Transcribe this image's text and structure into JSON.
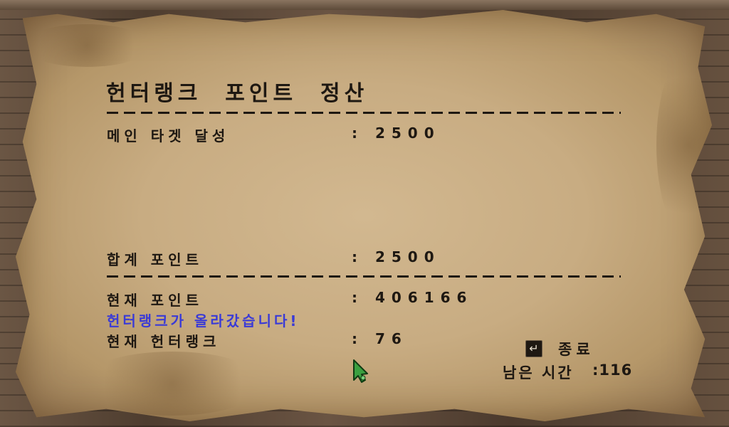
{
  "title": "헌터랭크  포인트  정산",
  "rows": {
    "main_target": {
      "label": "메인 타겟 달성",
      "value": ": 2500"
    },
    "total": {
      "label": "합계 포인트",
      "value": ": 2500"
    },
    "current_points": {
      "label": "현재 포인트",
      "value": ": 406166"
    },
    "rank_up_message": "헌터랭크가 올라갔습니다!",
    "current_rank": {
      "label": "현재 헌터랭크",
      "value": ": 76"
    }
  },
  "exit": {
    "label": "종료",
    "key_icon": "enter-key-icon"
  },
  "remaining": {
    "label": "남은 시간",
    "value": ":116"
  },
  "cursor_icon": "green-claw-cursor-icon"
}
